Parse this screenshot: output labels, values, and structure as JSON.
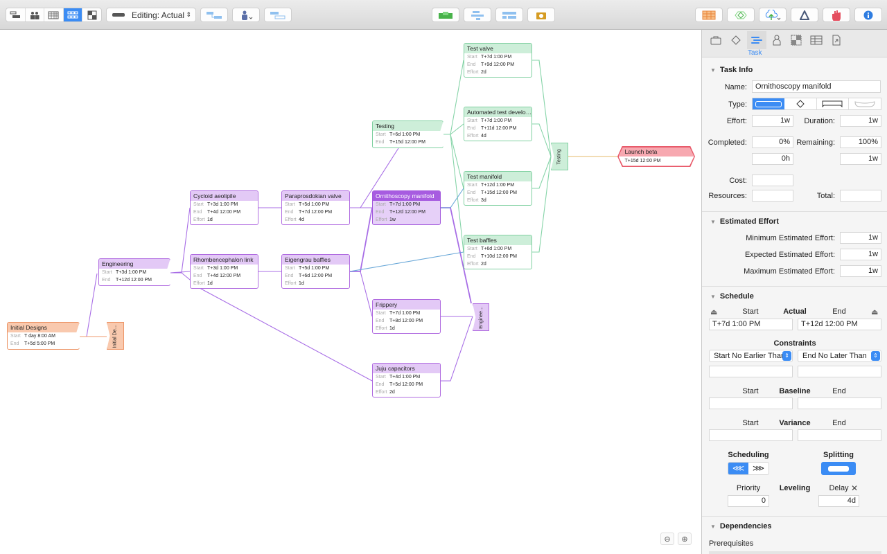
{
  "toolbar": {
    "view_modes": [
      {
        "name": "gantt-view",
        "icon": "gantt-icon",
        "active": false
      },
      {
        "name": "resource-view",
        "icon": "people-icon",
        "active": false
      },
      {
        "name": "calendar-view",
        "icon": "calendar-icon",
        "active": false
      },
      {
        "name": "network-view",
        "icon": "network-icon",
        "active": true
      },
      {
        "name": "styles-view",
        "icon": "styles-icon",
        "active": false
      }
    ],
    "editing_mode": "Editing: Actual",
    "left_buttons": [
      "connect-tasks-icon",
      "assign-resource-icon",
      "baseline-icon"
    ],
    "center_buttons": [
      "level-resources-icon",
      "add-task-icon",
      "indent-icon",
      "camera-icon"
    ],
    "right_buttons": [
      "table-icon",
      "milestone-icon",
      "publish-icon",
      "delta-icon",
      "stop-icon",
      "info-icon"
    ]
  },
  "network": {
    "labels": {
      "start": "Start",
      "end": "End",
      "effort": "Effort"
    },
    "nodes": [
      {
        "id": "initial-designs",
        "title": "Initial Designs",
        "start": "T day 8:00 AM",
        "end": "T+5d 5:00 PM",
        "style": "orange"
      },
      {
        "id": "engineering",
        "title": "Engineering",
        "start": "T+3d 1:00 PM",
        "end": "T+12d 12:00 PM",
        "style": "purple"
      },
      {
        "id": "cycloid",
        "title": "Cycloid aeolipile",
        "start": "T+3d 1:00 PM",
        "end": "T+4d 12:00 PM",
        "effort": "1d",
        "style": "purple"
      },
      {
        "id": "rhomb",
        "title": "Rhombencephalon link",
        "start": "T+3d 1:00 PM",
        "end": "T+4d 12:00 PM",
        "effort": "1d",
        "style": "purple"
      },
      {
        "id": "paraprosdokian",
        "title": "Paraprosdokian valve",
        "start": "T+5d 1:00 PM",
        "end": "T+7d 12:00 PM",
        "effort": "4d",
        "style": "purple"
      },
      {
        "id": "eigengrau",
        "title": "Eigengrau baffles",
        "start": "T+5d 1:00 PM",
        "end": "T+6d 12:00 PM",
        "effort": "1d",
        "style": "purple"
      },
      {
        "id": "testing",
        "title": "Testing",
        "start": "T+6d 1:00 PM",
        "end": "T+15d 12:00 PM",
        "style": "green"
      },
      {
        "id": "ornithoscopy",
        "title": "Ornithoscopy manifold",
        "start": "T+7d 1:00 PM",
        "end": "T+12d 12:00 PM",
        "effort": "1w",
        "style": "selected"
      },
      {
        "id": "frippery",
        "title": "Frippery",
        "start": "T+7d 1:00 PM",
        "end": "T+8d 12:00 PM",
        "effort": "1d",
        "style": "purple"
      },
      {
        "id": "juju",
        "title": "Juju capacitors",
        "start": "T+4d 1:00 PM",
        "end": "T+5d 12:00 PM",
        "effort": "2d",
        "style": "purple"
      },
      {
        "id": "test-valve",
        "title": "Test valve",
        "start": "T+7d 1:00 PM",
        "end": "T+9d 12:00 PM",
        "effort": "2d",
        "style": "green"
      },
      {
        "id": "auto-test",
        "title": "Automated test develo…",
        "start": "T+7d 1:00 PM",
        "end": "T+11d 12:00 PM",
        "effort": "4d",
        "style": "green"
      },
      {
        "id": "test-manifold",
        "title": "Test manifold",
        "start": "T+12d 1:00 PM",
        "end": "T+15d 12:00 PM",
        "effort": "3d",
        "style": "green"
      },
      {
        "id": "test-baffles",
        "title": "Test baffles",
        "start": "T+6d 1:00 PM",
        "end": "T+10d 12:00 PM",
        "effort": "2d",
        "style": "green"
      }
    ],
    "group_ends": [
      {
        "id": "initial-designs-end",
        "label": "Initial De…",
        "style": "orange"
      },
      {
        "id": "engineering-end",
        "label": "Enginee…",
        "style": "purple"
      },
      {
        "id": "testing-end",
        "label": "Testing",
        "style": "green"
      }
    ],
    "milestone": {
      "title": "Launch beta",
      "date": "T+15d 12:00 PM"
    }
  },
  "inspector": {
    "tabs": [
      {
        "name": "project",
        "icon": "briefcase-icon"
      },
      {
        "name": "milestone",
        "icon": "diamond-icon"
      },
      {
        "name": "task",
        "icon": "task-icon",
        "label": "Task",
        "active": true
      },
      {
        "name": "resource",
        "icon": "person-icon"
      },
      {
        "name": "styles",
        "icon": "styles-icon"
      },
      {
        "name": "columns",
        "icon": "table-icon"
      },
      {
        "name": "export",
        "icon": "export-icon"
      }
    ],
    "task_info": {
      "title": "Task Info",
      "name_label": "Name:",
      "name": "Ornithoscopy manifold",
      "type_label": "Type:",
      "type_options": [
        "task",
        "milestone",
        "group",
        "hammock"
      ],
      "type_selected": "task",
      "effort_label": "Effort:",
      "effort": "1w",
      "duration_label": "Duration:",
      "duration": "1w",
      "completed_label": "Completed:",
      "completed": "0%",
      "completed_time": "0h",
      "remaining_label": "Remaining:",
      "remaining": "100%",
      "remaining_time": "1w",
      "cost_label": "Cost:",
      "cost": "",
      "resources_label": "Resources:",
      "resources": "",
      "total_label": "Total:",
      "total": ""
    },
    "estimated_effort": {
      "title": "Estimated Effort",
      "min_label": "Minimum Estimated Effort:",
      "min": "1w",
      "expected_label": "Expected Estimated Effort:",
      "expected": "1w",
      "max_label": "Maximum Estimated Effort:",
      "max": "1w"
    },
    "schedule": {
      "title": "Schedule",
      "start_label": "Start",
      "end_label": "End",
      "actual_label": "Actual",
      "actual_start": "T+7d 1:00 PM",
      "actual_end": "T+12d 12:00 PM",
      "constraints_label": "Constraints",
      "constraint_start": "Start No Earlier Than",
      "constraint_end": "End No Later Than",
      "constraint_start_value": "",
      "constraint_end_value": "",
      "baseline_label": "Baseline",
      "baseline_start": "",
      "baseline_end": "",
      "variance_label": "Variance",
      "variance_start": "",
      "variance_end": "",
      "scheduling_label": "Scheduling",
      "scheduling_selected": "as-soon-as-possible",
      "splitting_label": "Splitting",
      "splitting_on": true,
      "priority_label": "Priority",
      "priority": "0",
      "leveling_label": "Leveling",
      "delay_label": "Delay",
      "delay": "4d"
    },
    "dependencies": {
      "title": "Dependencies",
      "prerequisites_label": "Prerequisites"
    }
  }
}
